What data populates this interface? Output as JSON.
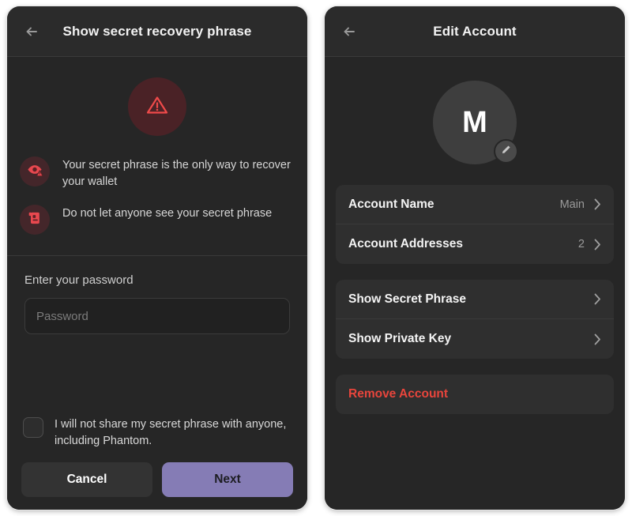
{
  "left_panel": {
    "header": {
      "back_icon": "arrow-left-icon",
      "title": "Show secret recovery phrase"
    },
    "warning_badge_icon": "warning-triangle-icon",
    "warnings": [
      {
        "icon": "eye-warning-icon",
        "text": "Your secret phrase is the only way to recover your wallet"
      },
      {
        "icon": "scroll-document-icon",
        "text": "Do not let anyone see your secret phrase"
      }
    ],
    "password": {
      "label": "Enter your password",
      "placeholder": "Password",
      "value": ""
    },
    "agreement": {
      "text": "I will not share my secret phrase with anyone, including Phantom.",
      "checked": false
    },
    "buttons": {
      "cancel": "Cancel",
      "next": "Next"
    },
    "colors": {
      "accent": "#857cb5",
      "danger": "#e8453c",
      "panel": "#262626"
    }
  },
  "right_panel": {
    "header": {
      "back_icon": "arrow-left-icon",
      "title": "Edit Account"
    },
    "avatar": {
      "initial": "M",
      "edit_icon": "pencil-icon"
    },
    "sections": [
      {
        "rows": [
          {
            "label": "Account Name",
            "value": "Main",
            "chevron": "chevron-right-icon"
          },
          {
            "label": "Account Addresses",
            "value": "2",
            "chevron": "chevron-right-icon"
          }
        ]
      },
      {
        "rows": [
          {
            "label": "Show Secret Phrase",
            "value": "",
            "chevron": "chevron-right-icon"
          },
          {
            "label": "Show Private Key",
            "value": "",
            "chevron": "chevron-right-icon"
          }
        ]
      }
    ],
    "remove": {
      "label": "Remove Account"
    }
  }
}
